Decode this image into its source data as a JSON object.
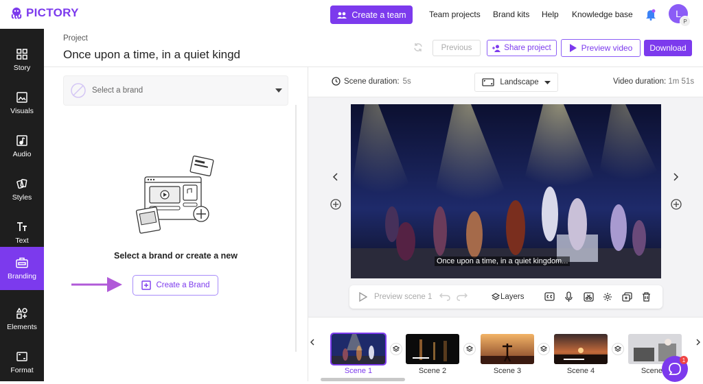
{
  "app": {
    "logo_text": "PICTORY"
  },
  "topnav": {
    "create_team": "Create a team",
    "team_projects": "Team projects",
    "brand_kits": "Brand kits",
    "help": "Help",
    "knowledge_base": "Knowledge base",
    "avatar_initial": "L",
    "avatar_sub": "P"
  },
  "sidebar": {
    "items": [
      {
        "label": "Story",
        "icon": "story-icon"
      },
      {
        "label": "Visuals",
        "icon": "visuals-icon"
      },
      {
        "label": "Audio",
        "icon": "audio-icon"
      },
      {
        "label": "Styles",
        "icon": "styles-icon"
      },
      {
        "label": "Text",
        "icon": "text-icon"
      },
      {
        "label": "Branding",
        "icon": "branding-icon",
        "active": true
      },
      {
        "label": "Elements",
        "icon": "elements-icon"
      },
      {
        "label": "Format",
        "icon": "format-icon"
      }
    ]
  },
  "project": {
    "label": "Project",
    "title": "Once upon a time, in a quiet kingdom"
  },
  "actions": {
    "previous": "Previous",
    "share": "Share project",
    "preview": "Preview video",
    "download": "Download"
  },
  "branding": {
    "select_placeholder": "Select a brand",
    "empty_message": "Select a brand or create a new",
    "create_button": "Create a Brand"
  },
  "stage": {
    "scene_duration_label": "Scene duration:",
    "scene_duration_value": "5s",
    "format": "Landscape",
    "video_duration_label": "Video duration:",
    "video_duration_value": "1m 51s",
    "subtitle": "Once upon a time, in a quiet kingdom..."
  },
  "controls": {
    "preview_scene": "Preview scene 1",
    "layers": "Layers"
  },
  "timeline": {
    "scenes": [
      "Scene 1",
      "Scene 2",
      "Scene 3",
      "Scene 4",
      "Scene 5"
    ],
    "selected_index": 0
  },
  "chat": {
    "badge": "1"
  },
  "colors": {
    "accent": "#7c3aed",
    "sidebar": "#1e1e1e"
  }
}
